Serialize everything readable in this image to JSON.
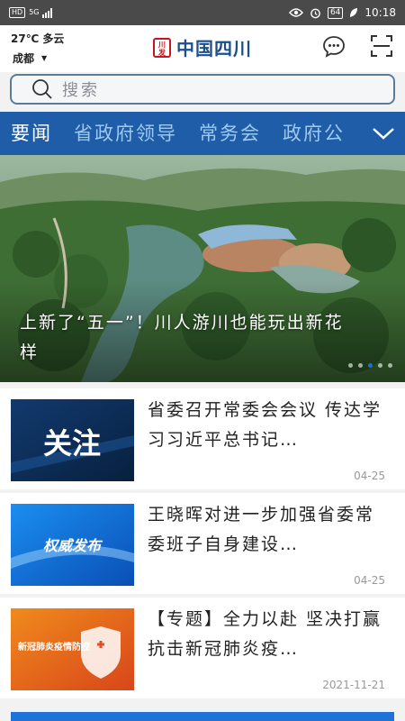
{
  "status_bar": {
    "left_badges": [
      "HD",
      "5G"
    ],
    "time": "10:18",
    "battery": "64",
    "icons": [
      "eye-icon",
      "alarm-icon",
      "battery-icon",
      "leaf-icon"
    ]
  },
  "header": {
    "weather": "27℃  多云",
    "city": "成都",
    "logo_seal": "四川发布",
    "logo_text": "中国四川",
    "icons": [
      "chat-icon",
      "scan-icon"
    ]
  },
  "search": {
    "placeholder": "搜索"
  },
  "tabs": [
    "要闻",
    "省政府领导",
    "常务会",
    "政府公"
  ],
  "banner": {
    "caption": "上新了“五一”！川人游川也能玩出新花样",
    "page_dots": 5,
    "active_dot": 3
  },
  "news": [
    {
      "title": "省委召开常委会会议 传达学习习近平总书记…",
      "date": "04-25",
      "thumb_text": "关注"
    },
    {
      "title": "王晓晖对进一步加强省委常委班子自身建设…",
      "date": "04-25",
      "thumb_text": "权威发布"
    },
    {
      "title": "【专题】全力以赴 坚决打赢抗击新冠肺炎疫…",
      "date": "2021-11-21",
      "thumb_text": "新冠肺炎疫情防控"
    }
  ],
  "colors": {
    "brand_blue": "#1f5da8",
    "tab_inactive": "#9ec9ef",
    "logo_red": "#c8161d"
  }
}
